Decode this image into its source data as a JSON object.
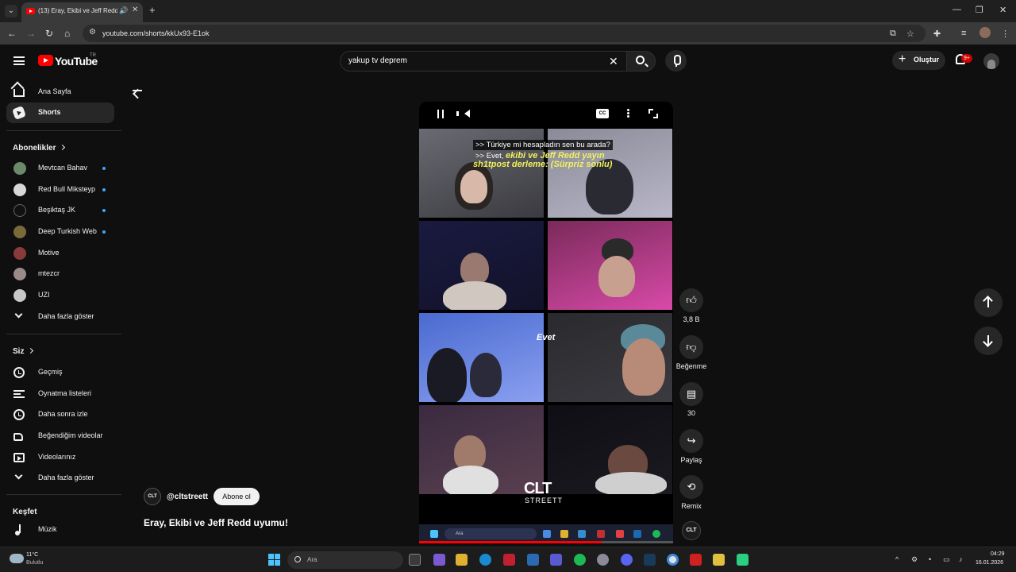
{
  "browser": {
    "tab_title": "(13) Eray, Ekibi ve Jeff Redd",
    "url": "youtube.com/shorts/kkUx93-E1ok"
  },
  "header": {
    "logo_text": "YouTube",
    "country_code": "TR",
    "search_query": "yakup tv deprem",
    "create_label": "Oluştur",
    "notification_badge": "9+"
  },
  "sidebar": {
    "main": [
      {
        "label": "Ana Sayfa",
        "icon": "home-icon"
      },
      {
        "label": "Shorts",
        "icon": "shorts-icon",
        "active": true
      }
    ],
    "subscriptions_title": "Abonelikler",
    "subscriptions": [
      {
        "label": "Mevtcan Bahav",
        "new": true,
        "color": "#6b8a6a"
      },
      {
        "label": "Red Bull Miksteyp",
        "new": true,
        "color": "#d8d8d8"
      },
      {
        "label": "Beşiktaş JK",
        "new": true,
        "color": "#111111"
      },
      {
        "label": "Deep Turkish Web",
        "new": true,
        "color": "#7a6a3a"
      },
      {
        "label": "Motive",
        "new": false,
        "color": "#8a3a3a"
      },
      {
        "label": "mtezcr",
        "new": false,
        "color": "#9a8a8a"
      },
      {
        "label": "UZI",
        "new": false,
        "color": "#c8c8c8"
      }
    ],
    "show_more_subs": "Daha fazla göster",
    "you_title": "Siz",
    "you": [
      {
        "label": "Geçmiş",
        "icon": "history-icon"
      },
      {
        "label": "Oynatma listeleri",
        "icon": "playlist-icon"
      },
      {
        "label": "Daha sonra izle",
        "icon": "watch-later-icon"
      },
      {
        "label": "Beğendiğim videolar",
        "icon": "liked-icon"
      },
      {
        "label": "Videolarınız",
        "icon": "your-videos-icon"
      }
    ],
    "show_more_you": "Daha fazla göster",
    "explore_title": "Keşfet",
    "explore": [
      {
        "label": "Müzik",
        "icon": "music-icon"
      }
    ]
  },
  "video": {
    "caption_line1": ">> Türkiye mi hesapladın sen bu arada?",
    "caption_line2_prefix": ">> Evet,",
    "caption_line2_yellow": "ekibi ve Jeff Redd yayın",
    "caption_line3_yellow": "sh1tpost derleme: (Sürpriz sonlu)",
    "overlay_word": "Evet",
    "watermark": "CLT",
    "watermark_sub": "STREETT",
    "inner_search": "Ara",
    "progress": 0.72
  },
  "actions": {
    "like_count": "3,8 B",
    "dislike_label": "Beğenme",
    "comment_count": "30",
    "share_label": "Paylaş",
    "remix_label": "Remix"
  },
  "channel": {
    "handle": "@cltstreett",
    "avatar_text": "CLT",
    "subscribe_label": "Abone ol",
    "video_title": "Eray, Ekibi ve Jeff Redd uyumu!"
  },
  "taskbar": {
    "temperature": "11°C",
    "weather": "Bulutlu",
    "search_label": "Ara",
    "time": "04:29",
    "date": "16.01.2026"
  }
}
